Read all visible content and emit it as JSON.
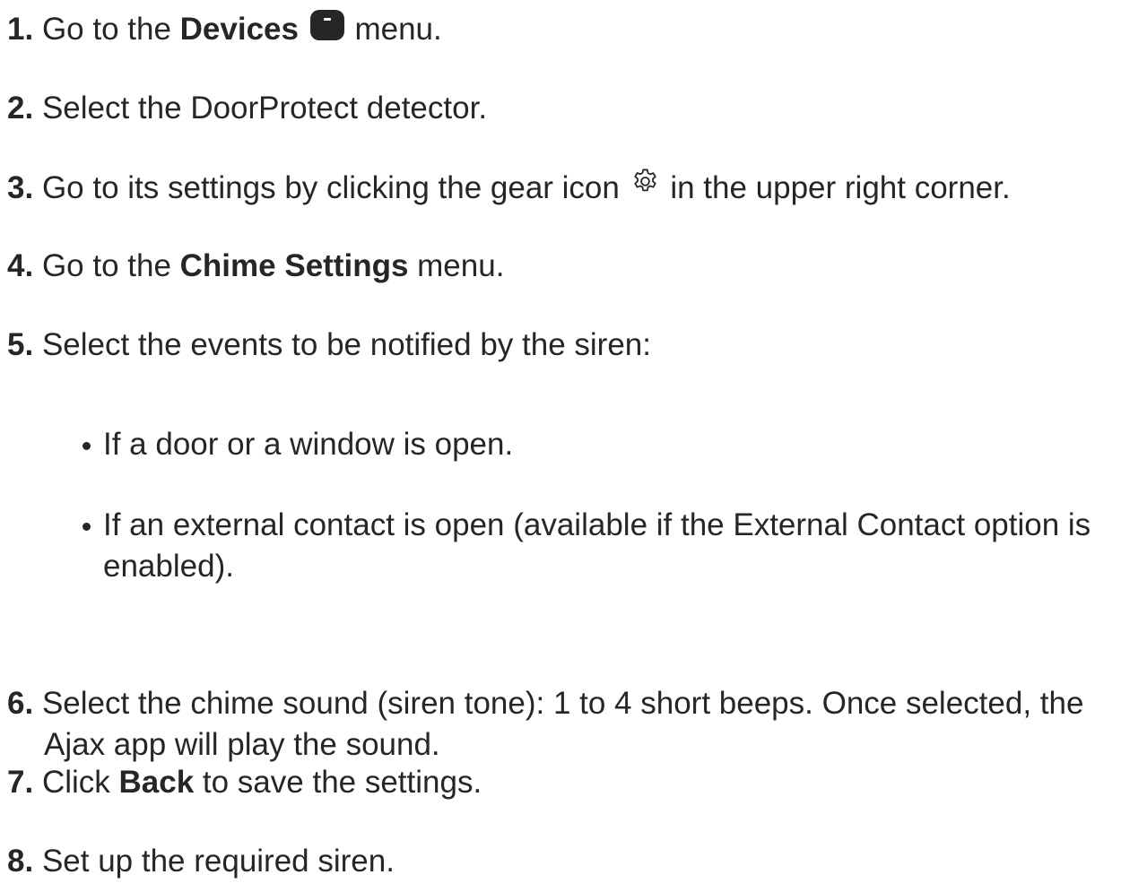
{
  "steps": [
    {
      "num": "1.",
      "pre": "Go to the ",
      "bold": "Devices",
      "post": " menu."
    },
    {
      "num": "2.",
      "text": "Select the DoorProtect detector."
    },
    {
      "num": "3.",
      "pre": "Go to its settings by clicking the gear icon ",
      "post": " in the upper right corner."
    },
    {
      "num": "4.",
      "pre": "Go to the ",
      "bold": "Chime Settings",
      "post": " menu."
    },
    {
      "num": "5.",
      "text": "Select the events to be notified by the siren:"
    },
    {
      "num": "6.",
      "line1": "Select the chime sound (siren tone): 1 to 4 short beeps. Once selected, the",
      "line2": "Ajax app will play the sound."
    },
    {
      "num": "7.",
      "pre": "Click ",
      "bold": "Back",
      "post": " to save the settings."
    },
    {
      "num": "8.",
      "text": "Set up the required siren."
    }
  ],
  "bullets": [
    {
      "text": "If a door or a window is open."
    },
    {
      "line1": "If an external contact is open (available if the External Contact option is",
      "line2": "enabled)."
    }
  ],
  "icons": {
    "devices": "devices-icon",
    "gear": "gear-icon"
  }
}
